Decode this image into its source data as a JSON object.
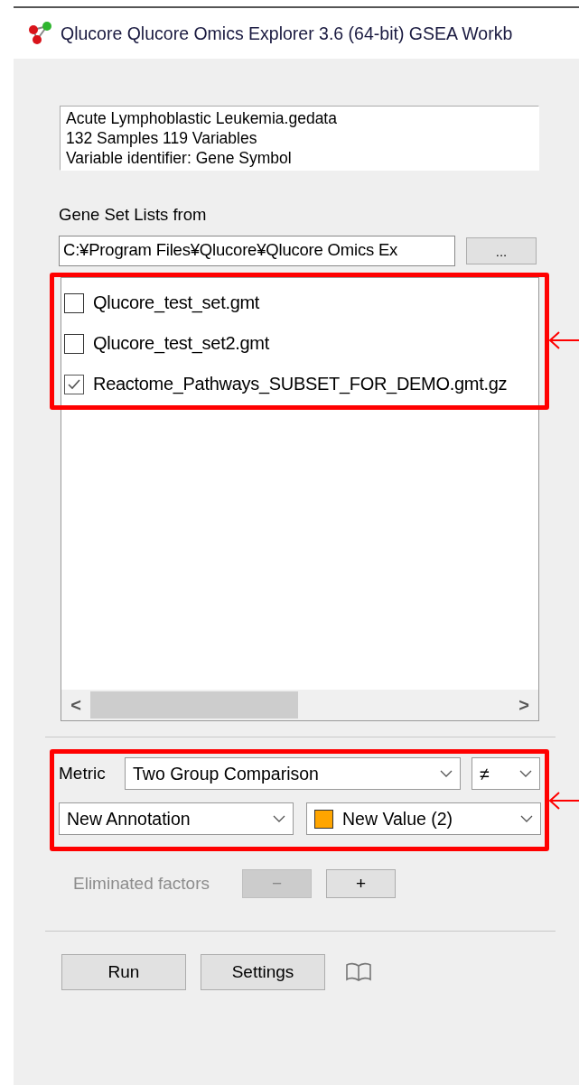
{
  "window": {
    "title": "Qlucore Qlucore Omics Explorer  3.6 (64-bit) GSEA Workb"
  },
  "dataset_info": {
    "lines": [
      "Acute Lymphoblastic Leukemia.gedata",
      "132 Samples 119 Variables",
      "Variable identifier: Gene Symbol"
    ]
  },
  "gene_set_lists": {
    "label": "Gene Set Lists from",
    "path": "C:¥Program Files¥Qlucore¥Qlucore Omics Ex",
    "browse_button": "...",
    "items": [
      {
        "label": "Qlucore_test_set.gmt",
        "checked": false
      },
      {
        "label": "Qlucore_test_set2.gmt",
        "checked": false
      },
      {
        "label": "Reactome_Pathways_SUBSET_FOR_DEMO.gmt.gz",
        "checked": true
      }
    ],
    "scroll_left": "<",
    "scroll_right": ">"
  },
  "metric": {
    "label": "Metric",
    "value": "Two Group Comparison",
    "operator": "≠",
    "annotation": "New Annotation",
    "group": {
      "value": "New Value (2)",
      "color": "#ffa500"
    }
  },
  "eliminated_factors": {
    "label": "Eliminated factors",
    "disabled": true,
    "buttons": [
      {
        "label": "−",
        "disabled": true
      },
      {
        "label": "+",
        "disabled": false
      }
    ]
  },
  "buttons": [
    "Run",
    "Settings"
  ]
}
